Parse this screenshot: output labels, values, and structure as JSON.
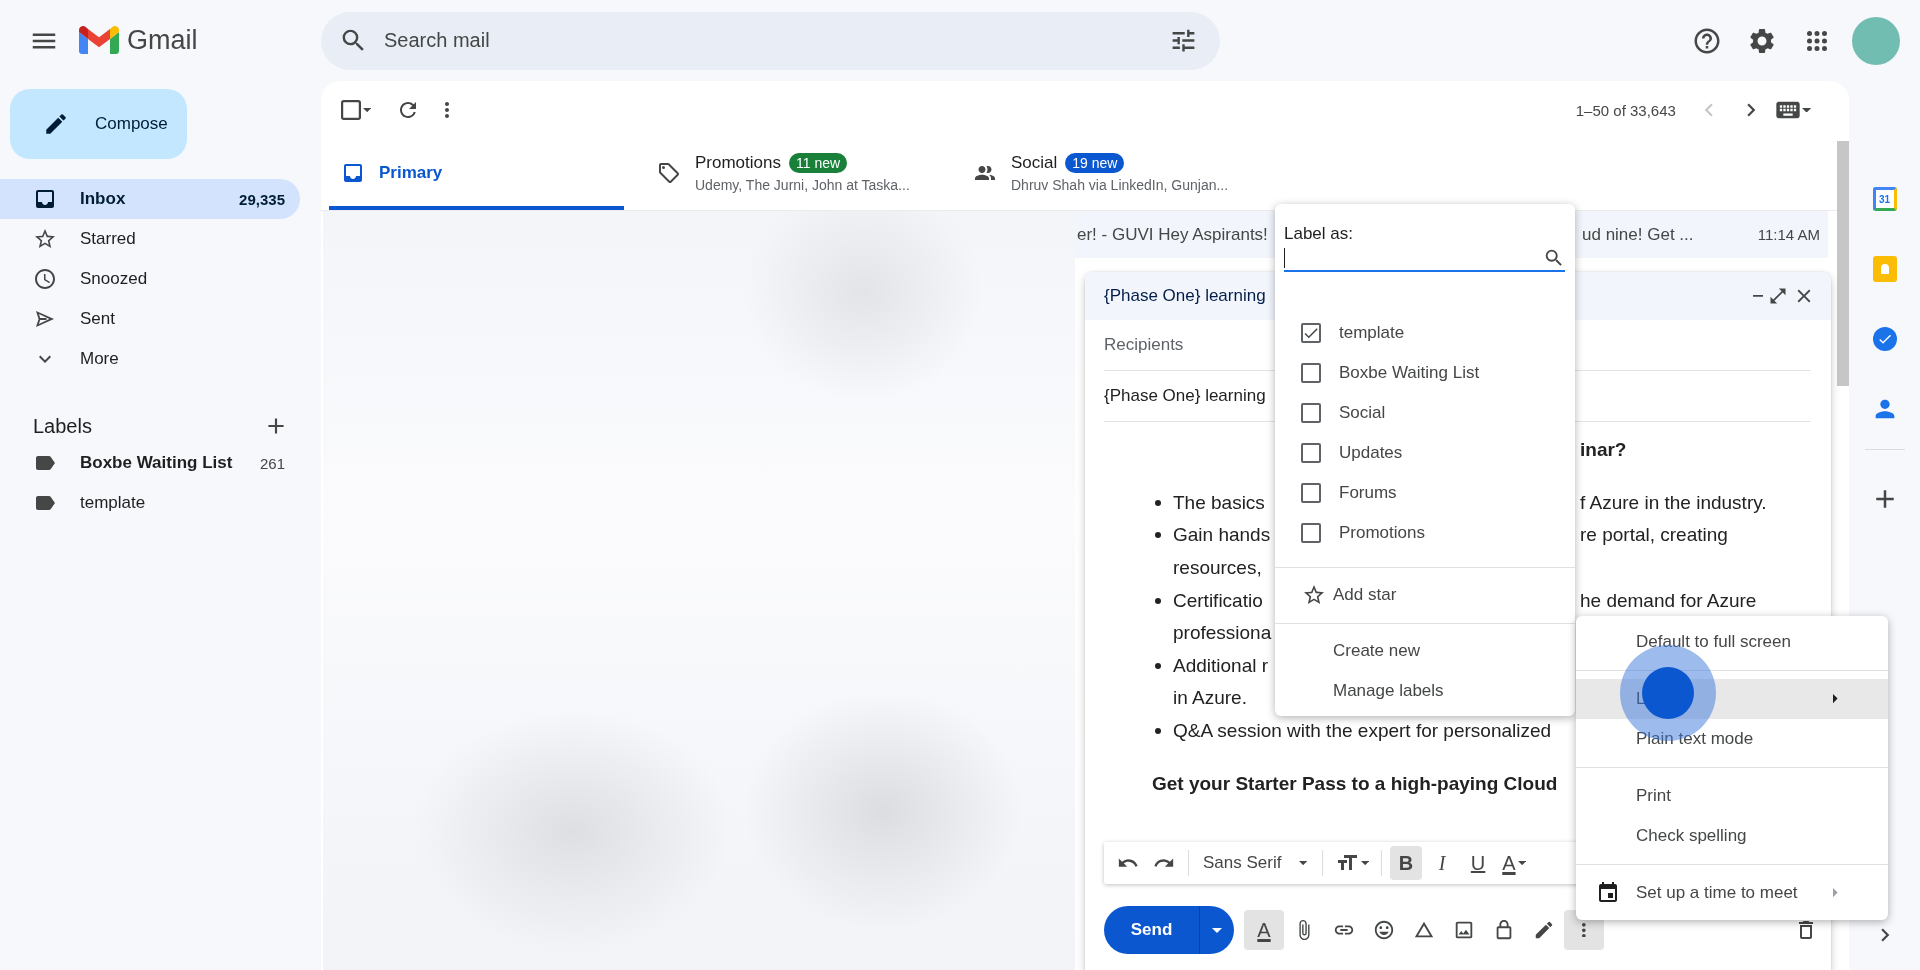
{
  "topbar": {
    "logo_text": "Gmail",
    "search": {
      "placeholder": "Search mail"
    }
  },
  "sidebar": {
    "compose": "Compose",
    "nav": [
      {
        "kind": "inbox",
        "label": "Inbox",
        "count": "29,335",
        "selected": true
      },
      {
        "kind": "star",
        "label": "Starred",
        "selected": false
      },
      {
        "kind": "clock",
        "label": "Snoozed",
        "selected": false
      },
      {
        "kind": "send",
        "label": "Sent",
        "selected": false
      },
      {
        "kind": "expand",
        "label": "More",
        "selected": false
      }
    ],
    "labels_heading": "Labels",
    "labels": [
      {
        "name": "Boxbe Waiting List",
        "count": "261",
        "unread": true
      },
      {
        "name": "template",
        "unread": false
      }
    ]
  },
  "mail_toolbar": {
    "select_all_checked": false,
    "range": "1–50 of 33,643",
    "prev_disabled": true
  },
  "tabs": [
    {
      "kind": "primary",
      "label": "Primary",
      "selected": true
    },
    {
      "kind": "promotions",
      "label": "Promotions",
      "badge": "11 new",
      "color": "#188038",
      "senders": "Udemy, The Jurni, John at Taska...",
      "selected": false
    },
    {
      "kind": "social",
      "label": "Social",
      "badge": "19 new",
      "color": "#0b57d0",
      "senders": "Dhruv Shah via LinkedIn, Gunjan...",
      "selected": false
    }
  ],
  "email_rows": [
    {
      "snippet_start": "er! - GUVI Hey Aspirants!",
      "snippet_end": "ud nine! Get ...",
      "time": "11:14 AM"
    }
  ],
  "rail": {
    "calendar_day": "31"
  },
  "compose": {
    "title": "{Phase One} learning",
    "recipients_placeholder": "Recipients",
    "subject": "{Phase One} learning",
    "body": [
      {
        "kind": "heading",
        "right": "inar?"
      },
      {
        "kind": "bullet",
        "left": "The basics",
        "right": "f Azure in the industry."
      },
      {
        "kind": "bullet",
        "left": "Gain hands",
        "right": "re portal, creating"
      },
      {
        "kind": "continued",
        "left": "resources,"
      },
      {
        "kind": "bullet",
        "left": "Certificatio",
        "right": "he demand for Azure"
      },
      {
        "kind": "continued",
        "left": "professiona"
      },
      {
        "kind": "bullet",
        "left": "Additional r"
      },
      {
        "kind": "continued",
        "left": "in Azure."
      },
      {
        "kind": "bullet",
        "left": "Q&A session with the expert for personalized"
      },
      {
        "kind": "heading",
        "left": "Get your Starter Pass to a high-paying Cloud"
      }
    ],
    "format_tools": [
      {
        "kind": "undo",
        "active": false
      },
      {
        "kind": "redo",
        "active": false
      },
      {
        "kind": "font",
        "label": "Sans Serif",
        "active": false
      },
      {
        "kind": "size",
        "active": false
      },
      {
        "kind": "bold",
        "glyph": "B",
        "active": true
      },
      {
        "kind": "italic",
        "glyph": "I",
        "active": false
      },
      {
        "kind": "underline",
        "glyph": "U",
        "active": false
      },
      {
        "kind": "color",
        "glyph": "A",
        "active": false
      }
    ],
    "send": "Send",
    "tools": [
      {
        "kind": "formatting",
        "glyph": "A",
        "active": true
      },
      {
        "kind": "attach",
        "active": false
      },
      {
        "kind": "link",
        "active": false
      },
      {
        "kind": "emoji",
        "active": false
      },
      {
        "kind": "drive",
        "active": false
      },
      {
        "kind": "photo",
        "active": false
      },
      {
        "kind": "confidential",
        "active": false
      },
      {
        "kind": "signature",
        "active": false
      },
      {
        "kind": "more",
        "active": true
      }
    ]
  },
  "label_menu": {
    "title": "Label as:",
    "labels": [
      {
        "name": "template",
        "checked": true
      },
      {
        "name": "Boxbe Waiting List",
        "checked": false
      },
      {
        "name": "Social",
        "checked": false
      },
      {
        "name": "Updates",
        "checked": false
      },
      {
        "name": "Forums",
        "checked": false
      },
      {
        "name": "Promotions",
        "checked": false
      }
    ],
    "actions": [
      {
        "kind": "star",
        "label": "Add star"
      },
      {
        "kind": "plain",
        "label": "Create new"
      },
      {
        "kind": "plain",
        "label": "Manage labels"
      }
    ]
  },
  "more_menu": {
    "groups": [
      {
        "items": [
          {
            "kind": "plain",
            "label": "Default to full screen",
            "highlighted": false,
            "submenu": false
          }
        ]
      },
      {
        "items": [
          {
            "kind": "plain",
            "label": "L",
            "highlighted": true,
            "submenu": true
          },
          {
            "kind": "plain",
            "label": "Plain text mode",
            "highlighted": false,
            "submenu": false
          }
        ]
      },
      {
        "items": [
          {
            "kind": "plain",
            "label": "Print",
            "highlighted": false,
            "submenu": false
          },
          {
            "kind": "plain",
            "label": "Check spelling",
            "highlighted": false,
            "submenu": false
          }
        ]
      },
      {
        "items": [
          {
            "kind": "meet",
            "label": "Set up a time to meet",
            "highlighted": false,
            "submenu": true
          }
        ]
      }
    ]
  }
}
